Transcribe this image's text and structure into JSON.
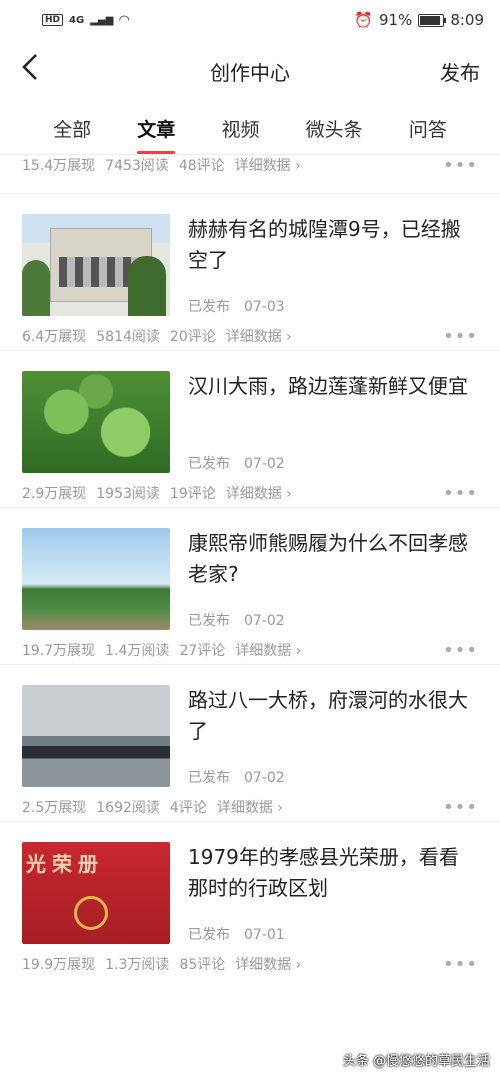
{
  "status_bar": {
    "network": "HD",
    "signal": "4G",
    "alarm_icon": "alarm-icon",
    "battery_percent": "91%",
    "battery_level": 0.91,
    "time": "8:09"
  },
  "nav": {
    "title": "创作中心",
    "publish": "发布"
  },
  "tabs": [
    "全部",
    "文章",
    "视频",
    "微头条",
    "问答"
  ],
  "active_tab": "文章",
  "top_stats": {
    "impressions": "15.4万展现",
    "reads": "7453阅读",
    "comments": "48评论",
    "details": "详细数据 ›"
  },
  "articles": [
    {
      "title": "赫赫有名的城隍潭9号，已经搬空了",
      "status": "已发布",
      "date": "07-03",
      "impressions": "6.4万展现",
      "reads": "5814阅读",
      "comments": "20评论",
      "details": "详细数据 ›"
    },
    {
      "title": "汉川大雨，路边莲蓬新鲜又便宜",
      "status": "已发布",
      "date": "07-02",
      "impressions": "2.9万展现",
      "reads": "1953阅读",
      "comments": "19评论",
      "details": "详细数据 ›"
    },
    {
      "title": "康熙帝师熊赐履为什么不回孝感老家?",
      "status": "已发布",
      "date": "07-02",
      "impressions": "19.7万展现",
      "reads": "1.4万阅读",
      "comments": "27评论",
      "details": "详细数据 ›"
    },
    {
      "title": "路过八一大桥，府澴河的水很大了",
      "status": "已发布",
      "date": "07-02",
      "impressions": "2.5万展现",
      "reads": "1692阅读",
      "comments": "4评论",
      "details": "详细数据 ›"
    },
    {
      "title": "1979年的孝感县光荣册，看看那时的行政区划",
      "status": "已发布",
      "date": "07-01",
      "impressions": "19.9万展现",
      "reads": "1.3万阅读",
      "comments": "85评论",
      "details": "详细数据 ›",
      "thumb_text": "光荣册"
    }
  ],
  "more_label": "•••",
  "watermark": "头条 @慢悠悠的草民生活"
}
